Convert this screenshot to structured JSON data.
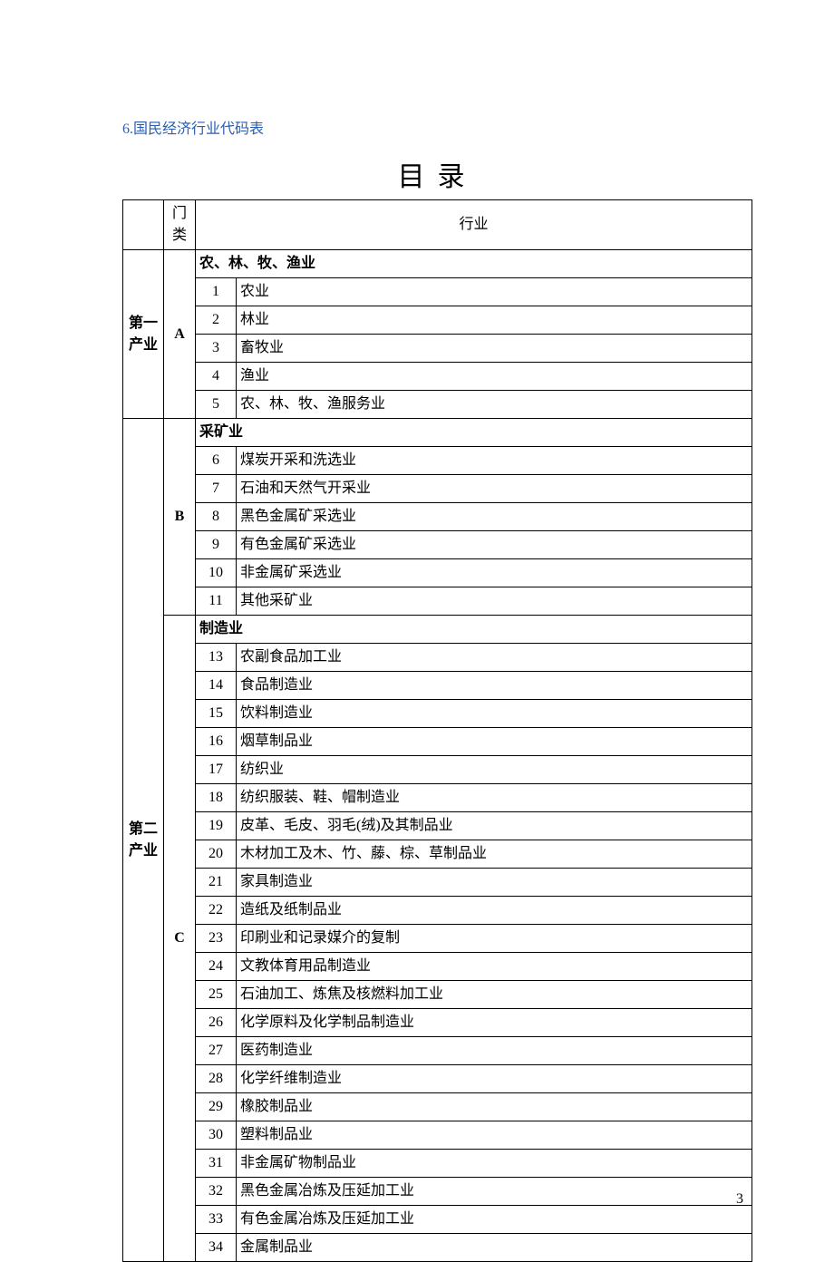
{
  "heading_prefix": "6.",
  "heading_text": "国民经济行业代码表",
  "toc_title": "目录",
  "page_number": "3",
  "th_empty": "",
  "th_category": "门类",
  "th_industry": "行业",
  "groups": [
    {
      "production_label": "第一产业",
      "category_code": "A",
      "section_title": "农、林、牧、渔业",
      "rows": [
        {
          "num": "1",
          "name": "农业"
        },
        {
          "num": "2",
          "name": "林业"
        },
        {
          "num": "3",
          "name": "畜牧业"
        },
        {
          "num": "4",
          "name": "渔业"
        },
        {
          "num": "5",
          "name": "农、林、牧、渔服务业"
        }
      ]
    },
    {
      "production_label": "第二产业",
      "sections": [
        {
          "category_code": "B",
          "section_title": "采矿业",
          "rows": [
            {
              "num": "6",
              "name": "煤炭开采和洗选业"
            },
            {
              "num": "7",
              "name": "石油和天然气开采业"
            },
            {
              "num": "8",
              "name": "黑色金属矿采选业"
            },
            {
              "num": "9",
              "name": "有色金属矿采选业"
            },
            {
              "num": "10",
              "name": "非金属矿采选业"
            },
            {
              "num": "11",
              "name": "其他采矿业"
            }
          ]
        },
        {
          "category_code": "C",
          "section_title": "制造业",
          "rows": [
            {
              "num": "13",
              "name": "农副食品加工业"
            },
            {
              "num": "14",
              "name": "食品制造业"
            },
            {
              "num": "15",
              "name": "饮料制造业"
            },
            {
              "num": "16",
              "name": "烟草制品业"
            },
            {
              "num": "17",
              "name": "纺织业"
            },
            {
              "num": "18",
              "name": "纺织服装、鞋、帽制造业"
            },
            {
              "num": "19",
              "name": "皮革、毛皮、羽毛(绒)及其制品业"
            },
            {
              "num": "20",
              "name": "木材加工及木、竹、藤、棕、草制品业"
            },
            {
              "num": "21",
              "name": "家具制造业"
            },
            {
              "num": "22",
              "name": "造纸及纸制品业"
            },
            {
              "num": "23",
              "name": "印刷业和记录媒介的复制"
            },
            {
              "num": "24",
              "name": "文教体育用品制造业"
            },
            {
              "num": "25",
              "name": "石油加工、炼焦及核燃料加工业"
            },
            {
              "num": "26",
              "name": "化学原料及化学制品制造业"
            },
            {
              "num": "27",
              "name": "医药制造业"
            },
            {
              "num": "28",
              "name": "化学纤维制造业"
            },
            {
              "num": "29",
              "name": "橡胶制品业"
            },
            {
              "num": "30",
              "name": "塑料制品业"
            },
            {
              "num": "31",
              "name": "非金属矿物制品业"
            },
            {
              "num": "32",
              "name": "黑色金属冶炼及压延加工业"
            },
            {
              "num": "33",
              "name": "有色金属冶炼及压延加工业"
            },
            {
              "num": "34",
              "name": "金属制品业"
            }
          ]
        }
      ]
    }
  ]
}
